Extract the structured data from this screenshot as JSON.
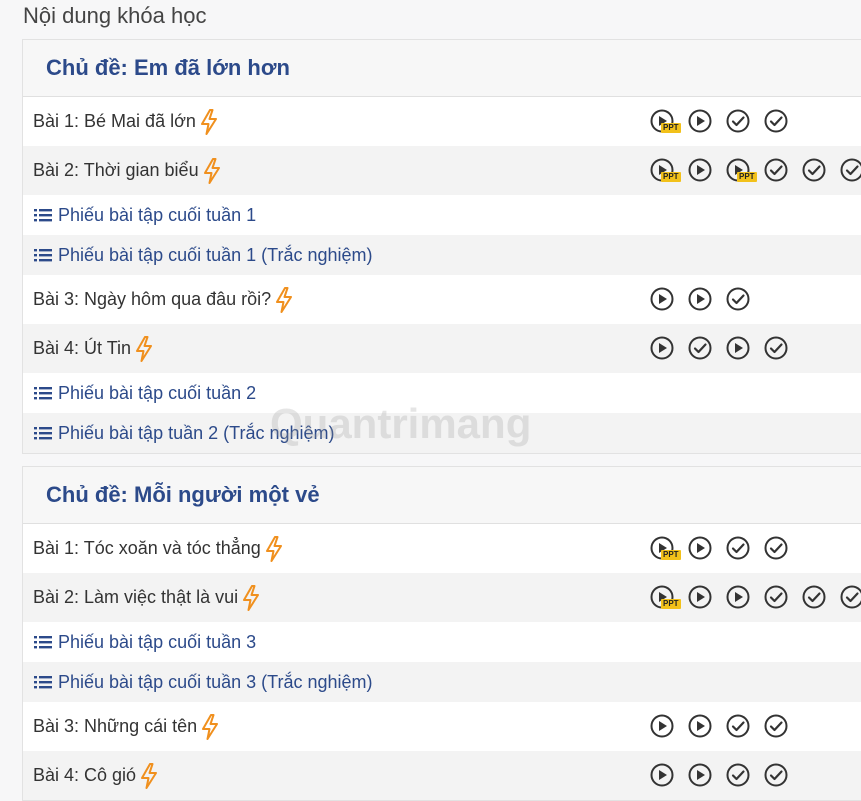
{
  "page_title": "Nội dung khóa học",
  "watermark": "Quantrimang",
  "colors": {
    "title": "#2c4a8a",
    "bolt": "#f0901e",
    "ppt_badge": "#f2c11a",
    "icon_stroke": "#333333"
  },
  "sections": [
    {
      "title": "Chủ đề: Em đã lớn hơn",
      "rows": [
        {
          "type": "lesson",
          "label": "Bài 1: Bé Mai đã lớn",
          "shade": false,
          "icons": [
            "play-ppt",
            "play",
            "check",
            "check"
          ]
        },
        {
          "type": "lesson",
          "label": "Bài 2: Thời gian biểu",
          "shade": true,
          "icons": [
            "play-ppt",
            "play",
            "play-ppt",
            "check",
            "check",
            "check"
          ]
        },
        {
          "type": "link",
          "label": "Phiếu bài tập cuối tuần 1",
          "shade": false
        },
        {
          "type": "link",
          "label": "Phiếu bài tập cuối tuần 1 (Trắc nghiệm)",
          "shade": true
        },
        {
          "type": "lesson",
          "label": "Bài 3: Ngày hôm qua đâu rồi?",
          "shade": false,
          "icons": [
            "play",
            "play",
            "check"
          ]
        },
        {
          "type": "lesson",
          "label": "Bài 4: Út Tin",
          "shade": true,
          "icons": [
            "play",
            "check",
            "play",
            "check"
          ]
        },
        {
          "type": "link",
          "label": "Phiếu bài tập cuối tuần 2",
          "shade": false
        },
        {
          "type": "link",
          "label": "Phiếu bài tập tuần 2 (Trắc nghiệm)",
          "shade": true
        }
      ]
    },
    {
      "title": "Chủ đề: Mỗi người một vẻ",
      "rows": [
        {
          "type": "lesson",
          "label": "Bài 1: Tóc xoăn và tóc thẳng",
          "shade": false,
          "icons": [
            "play-ppt",
            "play",
            "check",
            "check"
          ]
        },
        {
          "type": "lesson",
          "label": "Bài 2: Làm việc thật là vui",
          "shade": true,
          "icons": [
            "play-ppt",
            "play",
            "play",
            "check",
            "check",
            "check"
          ]
        },
        {
          "type": "link",
          "label": "Phiếu bài tập cuối tuần 3",
          "shade": false
        },
        {
          "type": "link",
          "label": "Phiếu bài tập cuối tuần 3 (Trắc nghiệm)",
          "shade": true
        },
        {
          "type": "lesson",
          "label": "Bài 3: Những cái tên",
          "shade": false,
          "icons": [
            "play",
            "play",
            "check",
            "check"
          ]
        },
        {
          "type": "lesson",
          "label": "Bài 4: Cô gió",
          "shade": true,
          "icons": [
            "play",
            "play",
            "check",
            "check"
          ]
        }
      ]
    }
  ]
}
